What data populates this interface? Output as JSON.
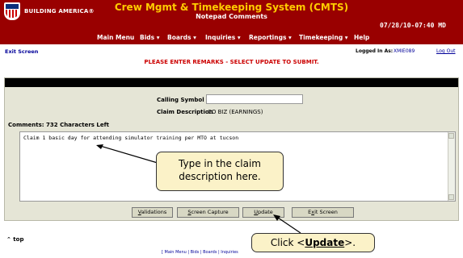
{
  "header": {
    "logo_text": "BUILDING AMERICA®",
    "system_title": "Crew Mgmt & Timekeeping System (CMTS)",
    "subtitle": "Notepad Comments",
    "datetime": "07/28/10-07:40 MD"
  },
  "menu": {
    "items": [
      {
        "label": "Main Menu"
      },
      {
        "label": "Bids ▾"
      },
      {
        "label": "Boards ▾"
      },
      {
        "label": "Inquiries ▾"
      },
      {
        "label": "Reportings ▾"
      },
      {
        "label": "Timekeeping ▾"
      },
      {
        "label": "Help"
      }
    ]
  },
  "session": {
    "exit_link": "Exit Screen",
    "logged_in_label": "Logged In As:",
    "user": "XMIE089",
    "logout_link": "Log Out"
  },
  "message": "PLEASE ENTER REMARKS - SELECT UPDATE TO SUBMIT.",
  "form": {
    "calling_symbol_label": "Calling Symbol",
    "calling_symbol_value": "",
    "claim_description_label": "Claim Description",
    "claim_description_value": "CO BIZ (EARNINGS)",
    "comments_label": "Comments:  732   Characters Left",
    "comments_text": "Claim 1 basic day for attending simulator training per MTO at tucson"
  },
  "buttons": {
    "validations": {
      "prefix": "",
      "underline": "V",
      "rest": "alidations"
    },
    "screen_capture": {
      "prefix": "",
      "underline": "S",
      "rest": "creen Capture"
    },
    "update": {
      "prefix": "",
      "underline": "U",
      "rest": "pdate"
    },
    "exit_screen": {
      "prefix": "E",
      "underline": "x",
      "rest": "it Screen"
    }
  },
  "footer": {
    "top_link": "⌃ top",
    "links": "[ Main Menu | Bids | Boards | Inquiries"
  },
  "callouts": {
    "claim_line1": "Type in the claim",
    "claim_line2": "description here.",
    "update_prefix": "Click <",
    "update_bold": "Update",
    "update_suffix": ">."
  },
  "colors": {
    "header_bg": "#990000",
    "title_yellow": "#ffcc00",
    "message_red": "#cc0000",
    "panel_bg": "#e5e5d6",
    "callout_bg": "#fbf2c8"
  }
}
